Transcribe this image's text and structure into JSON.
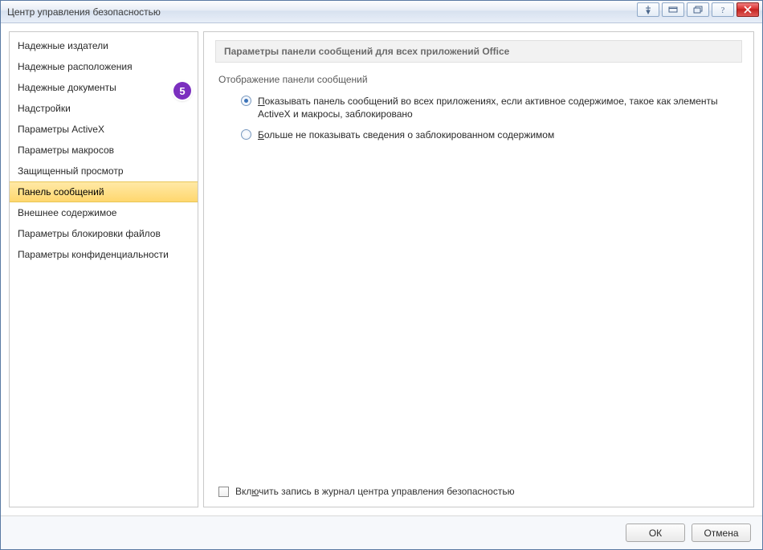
{
  "window": {
    "title": "Центр управления безопасностью"
  },
  "callout": {
    "number": "5"
  },
  "sidebar": {
    "items": [
      {
        "label": "Надежные издатели"
      },
      {
        "label": "Надежные расположения"
      },
      {
        "label": "Надежные документы"
      },
      {
        "label": "Надстройки"
      },
      {
        "label": "Параметры ActiveX"
      },
      {
        "label": "Параметры макросов"
      },
      {
        "label": "Защищенный просмотр"
      },
      {
        "label": "Панель сообщений"
      },
      {
        "label": "Внешнее содержимое"
      },
      {
        "label": "Параметры блокировки файлов"
      },
      {
        "label": "Параметры конфиденциальности"
      }
    ],
    "selected_index": 7
  },
  "content": {
    "header": "Параметры панели сообщений для всех приложений Office",
    "section_label": "Отображение панели сообщений",
    "radios": [
      {
        "underline": "П",
        "rest": "оказывать панель сообщений во всех приложениях, если активное содержимое, такое как элементы ActiveX и макросы, заблокировано",
        "checked": true
      },
      {
        "underline": "Б",
        "rest": "ольше не показывать сведения о заблокированном содержимом",
        "checked": false
      }
    ],
    "checkbox": {
      "pre": "Вкл",
      "underline": "ю",
      "post": "чить запись в журнал центра управления безопасностью",
      "checked": false
    }
  },
  "footer": {
    "ok": "ОК",
    "cancel": "Отмена"
  }
}
